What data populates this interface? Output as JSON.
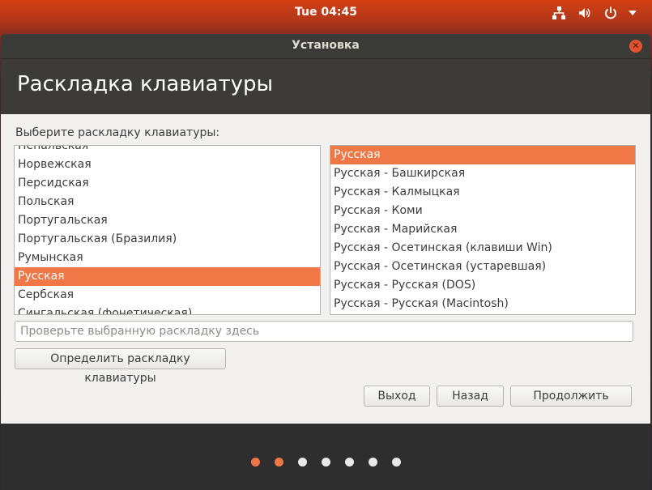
{
  "topbar": {
    "clock": "Tue 04:45",
    "icons": [
      "network-icon",
      "volume-icon",
      "power-icon",
      "chevron-down-icon"
    ]
  },
  "window": {
    "title": "Установка",
    "header": "Раскладка клавиатуры",
    "prompt": "Выберите раскладку клавиатуры:"
  },
  "layouts": [
    {
      "label": "Непальская",
      "selected": false
    },
    {
      "label": "Норвежская",
      "selected": false
    },
    {
      "label": "Персидская",
      "selected": false
    },
    {
      "label": "Польская",
      "selected": false
    },
    {
      "label": "Португальская",
      "selected": false
    },
    {
      "label": "Португальская (Бразилия)",
      "selected": false
    },
    {
      "label": "Румынская",
      "selected": false
    },
    {
      "label": "Русская",
      "selected": true
    },
    {
      "label": "Сербская",
      "selected": false
    },
    {
      "label": "Сингальская (фонетическая)",
      "selected": false
    }
  ],
  "variants": [
    {
      "label": "Русская",
      "selected": true
    },
    {
      "label": "Русская - Башкирская",
      "selected": false
    },
    {
      "label": "Русская - Калмыцкая",
      "selected": false
    },
    {
      "label": "Русская - Коми",
      "selected": false
    },
    {
      "label": "Русская - Марийская",
      "selected": false
    },
    {
      "label": "Русская - Осетинская (клавиши Win)",
      "selected": false
    },
    {
      "label": "Русская - Осетинская (устаревшая)",
      "selected": false
    },
    {
      "label": "Русская - Русская (DOS)",
      "selected": false
    },
    {
      "label": "Русская - Русская (Macintosh)",
      "selected": false
    }
  ],
  "test_input": {
    "value": "",
    "placeholder": "Проверьте выбранную раскладку здесь"
  },
  "buttons": {
    "detect": "Определить раскладку клавиатуры",
    "quit": "Выход",
    "back": "Назад",
    "next": "Продолжить"
  },
  "progress": {
    "steps": 7,
    "active": [
      0,
      1
    ]
  },
  "colors": {
    "accent": "#f07746",
    "close": "#e1522e"
  }
}
